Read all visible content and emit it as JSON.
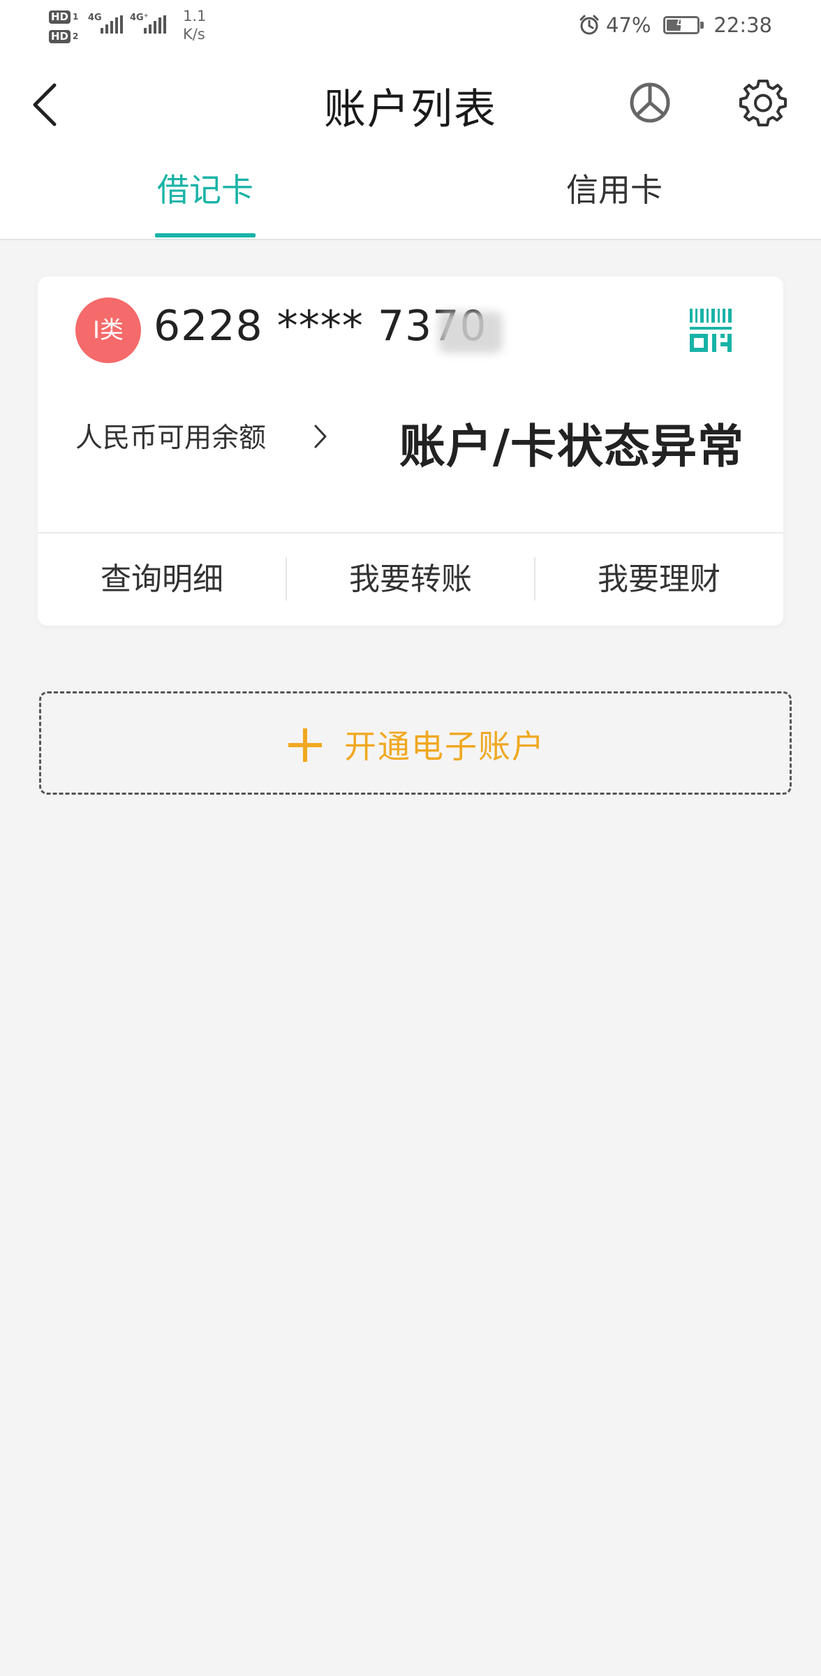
{
  "status_bar": {
    "hd1": "HD",
    "hd1_sub": "1",
    "hd2": "HD",
    "hd2_sub": "2",
    "sig1_label": "4G",
    "sig2_label": "4G⁺",
    "speed_value": "1.1",
    "speed_unit": "K/s",
    "battery_percent": "47%",
    "time": "22:38"
  },
  "header": {
    "title": "账户列表",
    "back_icon": "chevron-left-icon",
    "chart_icon": "pie-chart-icon",
    "settings_icon": "gear-icon"
  },
  "tabs": [
    {
      "label": "借记卡",
      "active": true
    },
    {
      "label": "信用卡",
      "active": false
    }
  ],
  "card": {
    "class_badge": "I类",
    "number": "6228  ****  7370",
    "balance_label": "人民币可用余额",
    "status": "账户/卡状态异常",
    "actions": [
      "查询明细",
      "我要转账",
      "我要理财"
    ],
    "qr_icon": "qr-code-icon"
  },
  "open_account": {
    "label": "开通电子账户"
  },
  "colors": {
    "accent": "#19b3a7",
    "badge": "#f56a6a",
    "open_account": "#f0a820",
    "background": "#f4f4f5"
  }
}
